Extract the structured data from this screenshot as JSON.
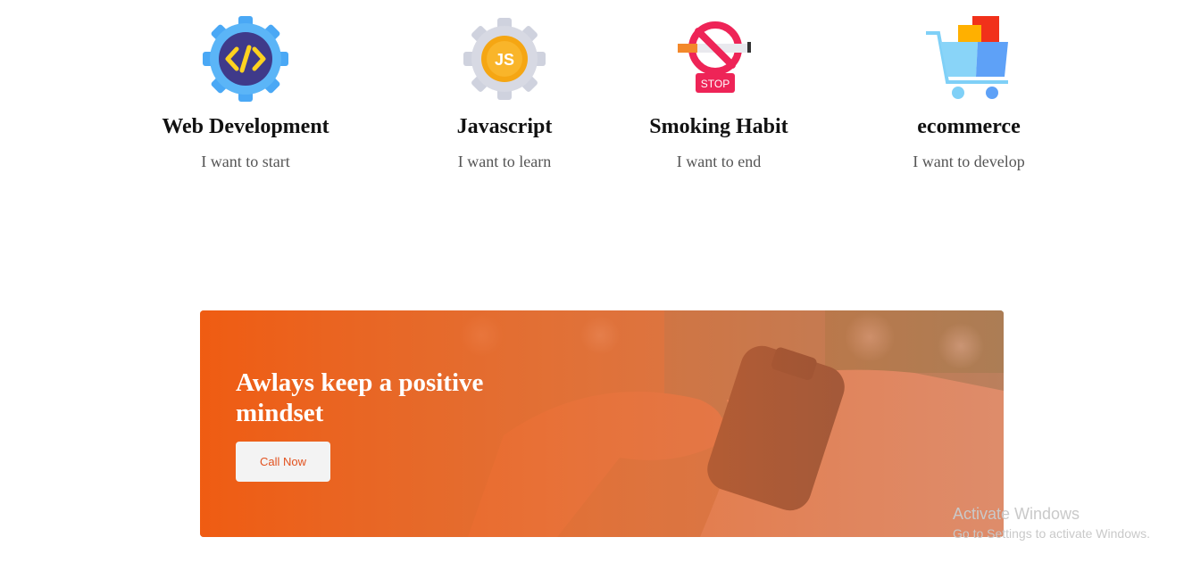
{
  "features": [
    {
      "icon": "code-gear-icon",
      "title": "Web Development",
      "subtitle": "I want to start"
    },
    {
      "icon": "js-gear-icon",
      "title": "Javascript",
      "subtitle": "I want to learn"
    },
    {
      "icon": "no-smoking-stop-icon",
      "title": "Smoking Habit",
      "subtitle": "I want to end",
      "badge": "STOP"
    },
    {
      "icon": "shopping-cart-icon",
      "title": "ecommerce",
      "subtitle": "I want to develop"
    }
  ],
  "banner": {
    "heading": "Awlays keep a positive mindset",
    "button_label": "Call Now",
    "accent_color": "#f15a0f"
  },
  "watermark": {
    "line1": "Activate Windows",
    "line2": "Go to Settings to activate Windows."
  }
}
